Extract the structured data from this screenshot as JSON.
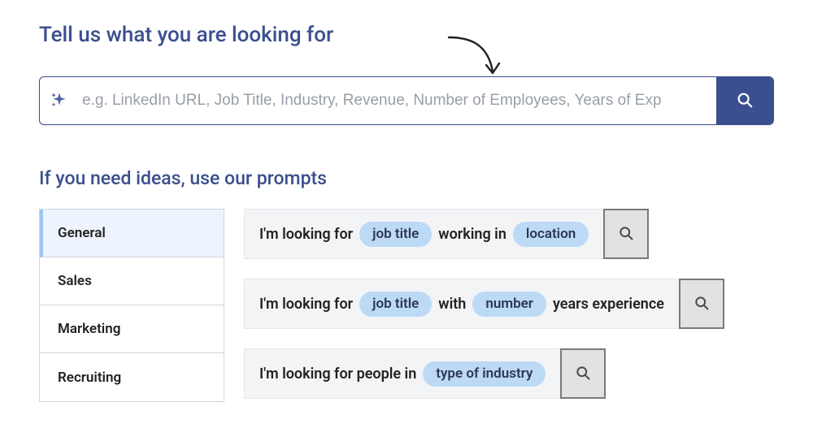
{
  "headline": "Tell us what you are looking for",
  "search": {
    "placeholder": "e.g. LinkedIn URL, Job Title, Industry, Revenue, Number of Employees, Years of Exp",
    "value": ""
  },
  "sub_headline": "If you need ideas, use our prompts",
  "tabs": [
    {
      "label": "General",
      "active": true
    },
    {
      "label": "Sales",
      "active": false
    },
    {
      "label": "Marketing",
      "active": false
    },
    {
      "label": "Recruiting",
      "active": false
    }
  ],
  "prompts": [
    {
      "parts": [
        {
          "type": "text",
          "value": "I'm looking for"
        },
        {
          "type": "chip",
          "value": "job title"
        },
        {
          "type": "text",
          "value": "working in"
        },
        {
          "type": "chip",
          "value": "location"
        }
      ]
    },
    {
      "parts": [
        {
          "type": "text",
          "value": "I'm looking for"
        },
        {
          "type": "chip",
          "value": "job title"
        },
        {
          "type": "text",
          "value": "with"
        },
        {
          "type": "chip",
          "value": "number"
        },
        {
          "type": "text",
          "value": "years experience"
        }
      ]
    },
    {
      "parts": [
        {
          "type": "text",
          "value": "I'm looking for people in"
        },
        {
          "type": "chip",
          "value": "type of industry"
        }
      ]
    }
  ]
}
